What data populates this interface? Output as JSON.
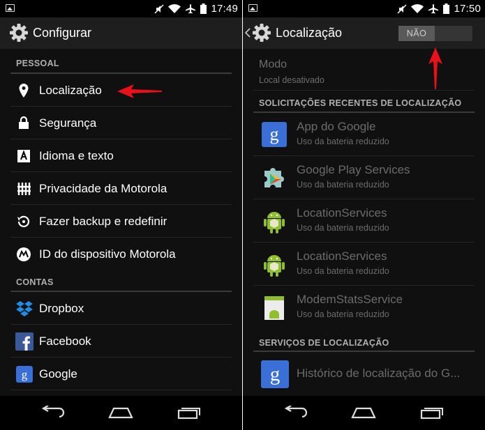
{
  "left": {
    "status": {
      "time": "17:49"
    },
    "title": "Configurar",
    "sections": [
      {
        "header": "PESSOAL",
        "items": [
          {
            "label": "Localização",
            "icon": "location-pin-icon"
          },
          {
            "label": "Segurança",
            "icon": "lock-icon"
          },
          {
            "label": "Idioma e texto",
            "icon": "language-icon"
          },
          {
            "label": "Privacidade da Motorola",
            "icon": "privacy-icon"
          },
          {
            "label": "Fazer backup e redefinir",
            "icon": "backup-icon"
          },
          {
            "label": "ID do dispositivo Motorola",
            "icon": "motorola-icon"
          }
        ]
      },
      {
        "header": "CONTAS",
        "items": [
          {
            "label": "Dropbox",
            "icon": "dropbox-icon"
          },
          {
            "label": "Facebook",
            "icon": "facebook-icon"
          },
          {
            "label": "Google",
            "icon": "google-icon"
          }
        ]
      }
    ]
  },
  "right": {
    "status": {
      "time": "17:50"
    },
    "title": "Localização",
    "toggle": {
      "label": "NÃO",
      "state": "off"
    },
    "mode": {
      "title": "Modo",
      "subtitle": "Local desativado"
    },
    "recent_header": "SOLICITAÇÕES RECENTES DE LOCALIZAÇÃO",
    "recent_apps": [
      {
        "name": "App do Google",
        "sub": "Uso da bateria reduzido",
        "icon": "google-app-icon"
      },
      {
        "name": "Google Play Services",
        "sub": "Uso da bateria reduzido",
        "icon": "play-services-icon"
      },
      {
        "name": "LocationServices",
        "sub": "Uso da bateria reduzido",
        "icon": "android-icon"
      },
      {
        "name": "LocationServices",
        "sub": "Uso da bateria reduzido",
        "icon": "android-icon"
      },
      {
        "name": "ModemStatsService",
        "sub": "Uso da bateria reduzido",
        "icon": "android-app-icon"
      }
    ],
    "services_header": "SERVIÇOS DE LOCALIZAÇÃO",
    "services": [
      {
        "name": "Histórico de localização do G...",
        "icon": "google-app-icon"
      }
    ]
  },
  "colors": {
    "accent_arrow": "#e8101a",
    "actionbar": "#1e1e1e",
    "background": "#101010"
  }
}
